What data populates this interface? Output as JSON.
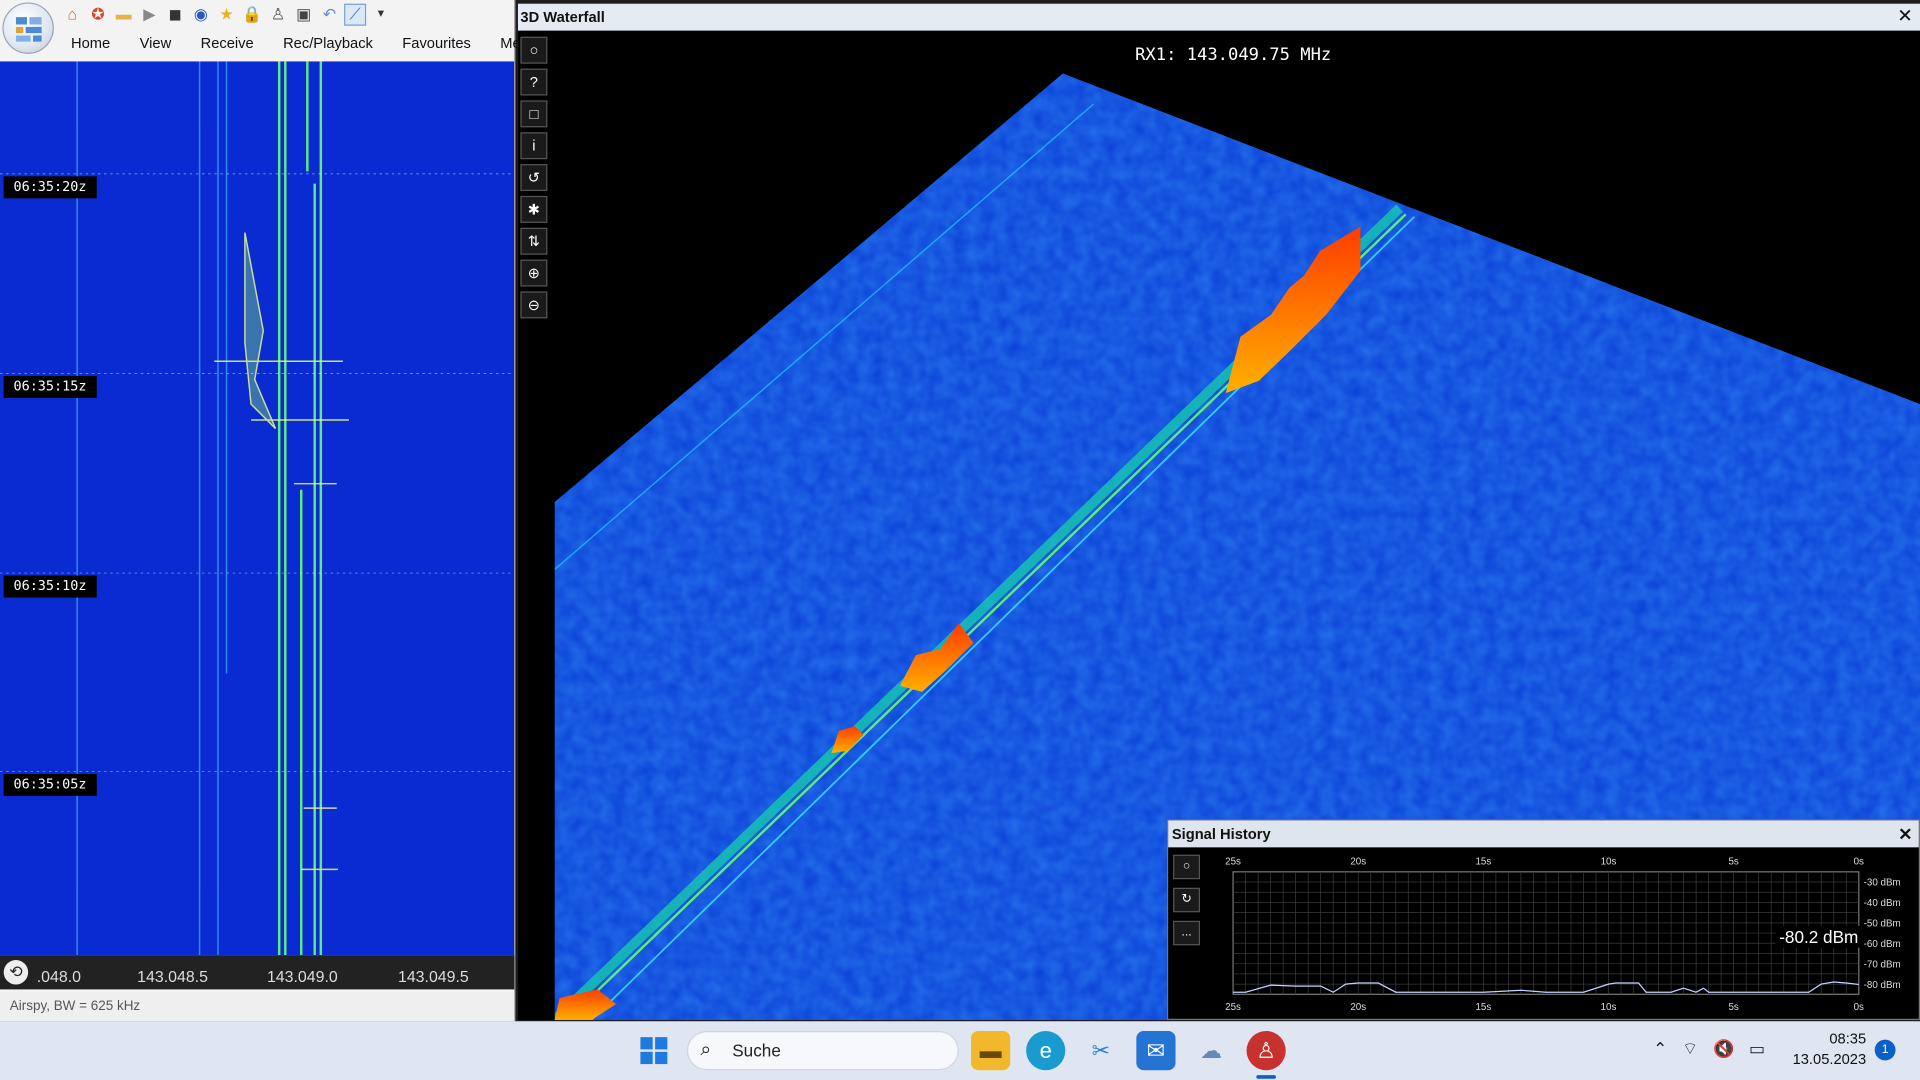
{
  "left_window": {
    "menu": [
      "Home",
      "View",
      "Receive",
      "Rec/Playback",
      "Favourites",
      "Memor"
    ],
    "quick_access_icons": [
      "home-icon",
      "lifebuoy-icon",
      "folder-icon",
      "play-icon",
      "stop-icon",
      "nav-icon",
      "star-icon",
      "lock-icon",
      "antenna-icon",
      "camera-icon",
      "undo-icon",
      "chart-icon",
      "dropdown-icon"
    ],
    "time_labels": [
      "06:35:20z",
      "06:35:15z",
      "06:35:10z",
      "06:35:05z"
    ],
    "freq_ticks": [
      ".048.0",
      "143.048.5",
      "143.049.0",
      "143.049.5"
    ],
    "status": "Airspy, BW = 625 kHz"
  },
  "waterfall3d": {
    "title": "3D Waterfall",
    "rx_label": "RX1: 143.049.75 MHz",
    "tools": [
      "○",
      "?",
      "□",
      "i",
      "↺",
      "✱",
      "⇅",
      "⊕",
      "⊖"
    ]
  },
  "signal_history": {
    "title": "Signal History",
    "tools": [
      "○",
      "↻",
      "..."
    ],
    "current_value": "-80.2 dBm",
    "chart_data": {
      "type": "line",
      "x_ticks": [
        "25s",
        "20s",
        "15s",
        "10s",
        "5s",
        "0s"
      ],
      "y_ticks": [
        "-30 dBm",
        "-40 dBm",
        "-50 dBm",
        "-60 dBm",
        "-70 dBm",
        "-80 dBm"
      ],
      "ylim": [
        -85,
        -25
      ],
      "series": [
        {
          "x": [
            25,
            24.5,
            23.5,
            22.5,
            21.5,
            21,
            20.5,
            20,
            19.2,
            18.5,
            15,
            13.5,
            12.5,
            11,
            10,
            9.7,
            8.8,
            8.5,
            7.5,
            7,
            6.5,
            6.2,
            6,
            5,
            2,
            1.5,
            1,
            0.5,
            0
          ],
          "y": [
            -84,
            -84,
            -80.5,
            -81,
            -81,
            -84,
            -80,
            -79.5,
            -79.5,
            -84,
            -84,
            -83,
            -84,
            -84,
            -80,
            -79.5,
            -79.5,
            -84,
            -84,
            -82,
            -84,
            -82,
            -84,
            -84,
            -84,
            -80,
            -79,
            -79.5,
            -80.2
          ]
        }
      ]
    }
  },
  "taskbar": {
    "search_placeholder": "Suche",
    "time": "08:35",
    "date": "13.05.2023",
    "notification_count": "1",
    "pinned_apps": [
      "windows-start-icon",
      "file-explorer-icon",
      "edge-icon",
      "snipping-tool-icon",
      "mail-icon",
      "weather-icon",
      "sdr-app-icon"
    ],
    "tray": [
      "chevron-up-icon",
      "wifi-icon",
      "speaker-muted-icon",
      "battery-icon"
    ]
  }
}
